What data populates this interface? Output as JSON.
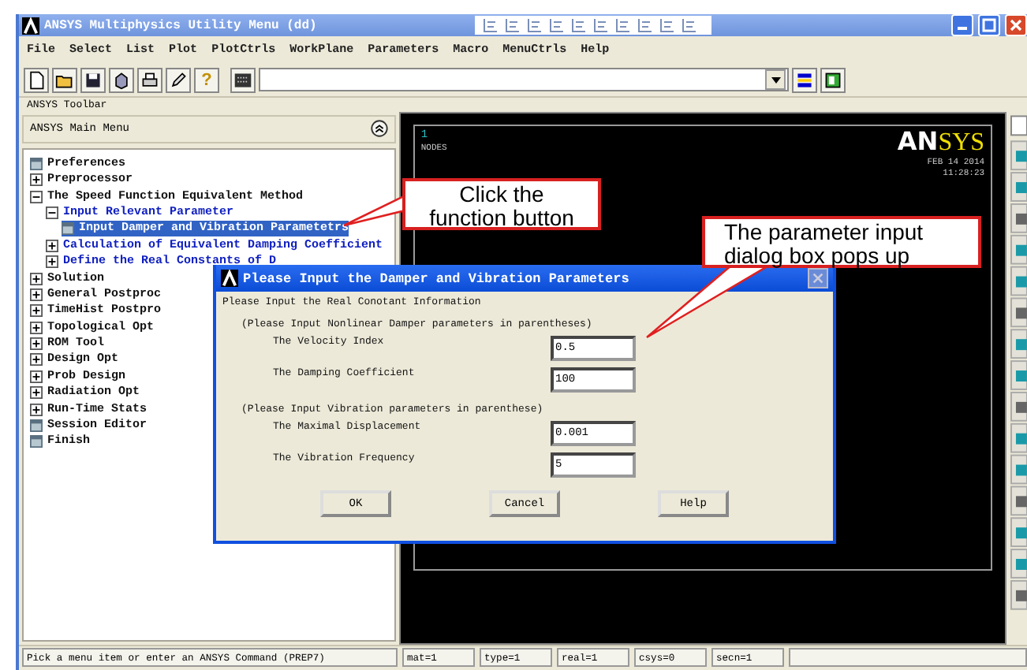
{
  "window": {
    "title": "ANSYS Multiphysics Utility Menu (dd)"
  },
  "menu_bar": [
    "File",
    "Select",
    "List",
    "Plot",
    "PlotCtrls",
    "WorkPlane",
    "Parameters",
    "Macro",
    "MenuCtrls",
    "Help"
  ],
  "toolbar": {
    "help_glyph": "?"
  },
  "toolbar_label": "ANSYS Toolbar",
  "main_menu": {
    "title": "ANSYS Main Menu",
    "items": [
      {
        "label": "Preferences",
        "kind": "item",
        "selected": false
      },
      {
        "label": "Preprocessor",
        "kind": "folder",
        "expanded": false,
        "selected": false
      },
      {
        "label": "The Speed Function Equivalent Method",
        "kind": "folder",
        "expanded": true,
        "selected": false,
        "children": [
          {
            "label": "Input Relevant Parameter",
            "kind": "folder",
            "expanded": true,
            "selected": false,
            "children": [
              {
                "label": "Input Damper and Vibration Parametetrs",
                "kind": "item",
                "selected": true
              }
            ]
          },
          {
            "label": "Calculation of Equivalent Damping Coefficient",
            "kind": "folder",
            "expanded": false,
            "selected": false
          },
          {
            "label": "Define the Real Constants of D",
            "kind": "folder",
            "expanded": false,
            "selected": false
          }
        ]
      },
      {
        "label": "Solution",
        "kind": "folder",
        "expanded": false,
        "selected": false
      },
      {
        "label": "General Postproc",
        "kind": "folder",
        "expanded": false,
        "selected": false
      },
      {
        "label": "TimeHist Postpro",
        "kind": "folder",
        "expanded": false,
        "selected": false
      },
      {
        "label": "Topological Opt",
        "kind": "folder",
        "expanded": false,
        "selected": false
      },
      {
        "label": "ROM Tool",
        "kind": "folder",
        "expanded": false,
        "selected": false
      },
      {
        "label": "Design Opt",
        "kind": "folder",
        "expanded": false,
        "selected": false
      },
      {
        "label": "Prob Design",
        "kind": "folder",
        "expanded": false,
        "selected": false
      },
      {
        "label": "Radiation Opt",
        "kind": "folder",
        "expanded": false,
        "selected": false
      },
      {
        "label": "Run-Time Stats",
        "kind": "folder",
        "expanded": false,
        "selected": false
      },
      {
        "label": "Session Editor",
        "kind": "item",
        "selected": false
      },
      {
        "label": "Finish",
        "kind": "item",
        "selected": false
      }
    ]
  },
  "graphics": {
    "window_number": "1",
    "label": "NODES",
    "logo": [
      "AN",
      "SYS"
    ],
    "date": "FEB 14 2014",
    "time": "11:28:23"
  },
  "dialog": {
    "title": "Please Input the Damper and Vibration Parameters",
    "heading": "Please Input the Real Conotant Information",
    "groups": [
      {
        "caption": "(Please Input Nonlinear Damper parameters in parentheses)",
        "fields": [
          {
            "label": "The Velocity Index",
            "value": "0.5"
          },
          {
            "label": "The Damping Coefficient",
            "value": "100"
          }
        ]
      },
      {
        "caption": "(Please Input Vibration parameters in parenthese)",
        "fields": [
          {
            "label": "The Maximal Displacement",
            "value": "0.001"
          },
          {
            "label": "The Vibration Frequency",
            "value": "5"
          }
        ]
      }
    ],
    "buttons": [
      "OK",
      "Cancel",
      "Help"
    ]
  },
  "callouts": [
    {
      "text": "Click the function button"
    },
    {
      "text": "The parameter input dialog box pops up"
    }
  ],
  "status_bar": {
    "prompt": "Pick a menu item or enter an ANSYS Command (PREP7)",
    "fields": [
      "mat=1",
      "type=1",
      "real=1",
      "csys=0",
      "secn=1"
    ]
  }
}
